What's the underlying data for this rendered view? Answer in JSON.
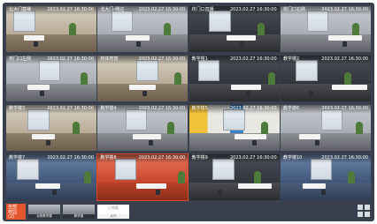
{
  "cameras": [
    {
      "name": "北大门直播",
      "time": "2023.02.27 16:30:00",
      "style": "warm"
    },
    {
      "name": "北大门-侧边",
      "time": "2023.02.27 16:30:00",
      "style": ""
    },
    {
      "name": "校门口直播",
      "time": "2023.02.27 16:30:00",
      "style": "dark"
    },
    {
      "name": "校门口右侧",
      "time": "2023.02.27 16:30:00",
      "style": ""
    },
    {
      "name": "校门口左侧",
      "time": "2023.02.27 16:30:00",
      "style": ""
    },
    {
      "name": "校体育馆",
      "time": "2023.02.27 16:30:00",
      "style": "warm"
    },
    {
      "name": "教学楼1",
      "time": "2023.02.27 16:30:00",
      "style": "dark"
    },
    {
      "name": "教学楼2",
      "time": "2023.02.27 16:30:00",
      "style": "dark"
    },
    {
      "name": "教学楼3",
      "time": "2023.02.27 16:30:00",
      "style": "warm"
    },
    {
      "name": "教学楼4",
      "time": "2023.02.27 16:30:00",
      "style": ""
    },
    {
      "name": "教学楼5",
      "time": "2023.02.27 16:30:00",
      "style": "color"
    },
    {
      "name": "教学楼6",
      "time": "2023.02.27 16:30:00",
      "style": ""
    },
    {
      "name": "教学楼7",
      "time": "2023.02.27 16:30:00",
      "style": "blue"
    },
    {
      "name": "教学楼8",
      "time": "2023.02.27 16:30:00",
      "style": "red"
    },
    {
      "name": "教学楼9",
      "time": "2023.02.27 16:30:00",
      "style": "dark"
    },
    {
      "name": "教学楼10",
      "time": "2023.02.27 16:30:00",
      "style": "blue"
    }
  ],
  "bottom_bar": {
    "filter_button_lines": [
      "全部",
      "校园",
      "(2)"
    ],
    "thumbs": [
      {
        "label": "北侧教学楼"
      },
      {
        "label": "教学楼"
      },
      {
        "top": "已隐藏",
        "label": "大厅"
      }
    ]
  },
  "colors": {
    "accent": "#e4572e",
    "background": "#3a3f4d",
    "active_outline": "#d9492c"
  }
}
